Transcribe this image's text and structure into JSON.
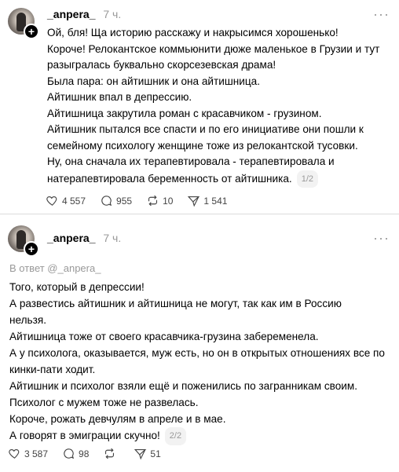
{
  "post1": {
    "username": "_anpera_",
    "time": "7 ч.",
    "paragraphs": [
      "Ой, бля! Ща историю расскажу и накрысимся хорошенько!",
      "Короче! Релокантское коммьюнити дюже маленькое в Грузии и тут разыгралась буквально скорсезевская драма!",
      "Была пара: он айтишник и она айтишница.",
      "Айтишник впал в депрессию.",
      "Айтишница закрутила роман с красавчиком - грузином.",
      "Айтишник пытался все спасти и по его инициативе они пошли к семейному психологу женщине тоже из релокантской тусовки.",
      "Ну, она сначала их терапевтировала - терапевтировала и натерапевтировала беременность от айтишника."
    ],
    "pager": "1/2",
    "likes": "4 557",
    "comments": "955",
    "reposts": "10",
    "shares": "1 541"
  },
  "post2": {
    "username": "_anpera_",
    "time": "7 ч.",
    "reply_to": "В ответ @_anpera_",
    "paragraphs": [
      "Того, который в депрессии!",
      "А развестись айтишник и айтишница не могут, так как им в Россию нельзя.",
      "Айтишница тоже от своего красавчика-грузина забеременела.",
      "А у психолога, оказывается, муж есть, но он в открытых отношениях все по кинки-пати ходит.",
      "Айтишник и психолог взяли ещё и поженились по загранникам своим.",
      "Психолог с мужем тоже не развелась.",
      "Короче, рожать девчулям в апреле и в мае.",
      "А говорят в эмиграции скучно!"
    ],
    "pager": "2/2",
    "likes": "3 587",
    "comments": "98",
    "reposts": "",
    "shares": "51"
  },
  "icons": {
    "more": "more-dots-icon",
    "like": "heart-icon",
    "comment": "comment-bubble-icon",
    "repost": "repost-arrows-icon",
    "share": "send-paper-plane-icon"
  }
}
